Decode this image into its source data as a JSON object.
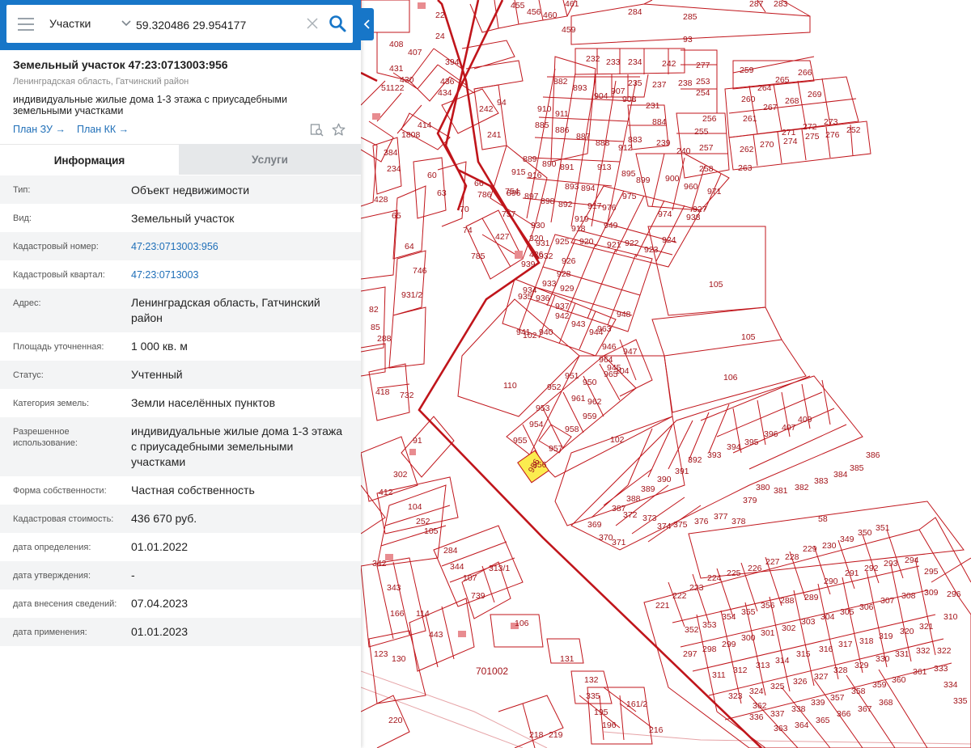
{
  "search": {
    "type_label": "Участки",
    "query": "59.320486 29.954177"
  },
  "parcel": {
    "title": "Земельный участок 47:23:0713003:956",
    "region": "Ленинградская область, Гатчинский район",
    "purpose": "индивидуальные жилые дома 1-3 этажа с приусадебными земельными участками",
    "plan_zu": "План ЗУ",
    "plan_kk": "План КК"
  },
  "tabs": {
    "info": "Информация",
    "services": "Услуги"
  },
  "rows": [
    {
      "label": "Тип:",
      "value": "Объект недвижимости"
    },
    {
      "label": "Вид:",
      "value": "Земельный участок"
    },
    {
      "label": "Кадастровый номер:",
      "value": "47:23:0713003:956"
    },
    {
      "label": "Кадастровый квартал:",
      "value": "47:23:0713003"
    },
    {
      "label": "Адрес:",
      "value": "Ленинградская область, Гатчинский район"
    },
    {
      "label": "Площадь уточненная:",
      "value": "1 000 кв. м"
    },
    {
      "label": "Статус:",
      "value": "Учтенный"
    },
    {
      "label": "Категория земель:",
      "value": "Земли населённых пунктов"
    },
    {
      "label": "Разрешенное использование:",
      "value": "индивидуальные жилые дома 1-3 этажа с приусадебными земельными участками"
    },
    {
      "label": "Форма собственности:",
      "value": "Частная собственность"
    },
    {
      "label": "Кадастровая стоимость:",
      "value": "436 670 руб."
    },
    {
      "label": "дата определения:",
      "value": "01.01.2022"
    },
    {
      "label": "дата утверждения:",
      "value": "-"
    },
    {
      "label": "дата внесения сведений:",
      "value": "07.04.2023"
    },
    {
      "label": "дата применения:",
      "value": "01.01.2023"
    }
  ],
  "map": {
    "selected_parcel": "956",
    "quarter_label": "701002",
    "plot_color": "#c0151b",
    "selected_color": "#fbec4f",
    "labels": [
      "93",
      "284",
      "285",
      "287",
      "283",
      "455",
      "456",
      "460",
      "461",
      "459",
      "22",
      "24",
      "408",
      "407",
      "431",
      "430",
      "51122",
      "394",
      "436",
      "434",
      "232",
      "233",
      "234",
      "242",
      "277",
      "253",
      "254",
      "259",
      "264",
      "265",
      "266",
      "260",
      "267",
      "268",
      "269",
      "882",
      "893",
      "904",
      "907",
      "908",
      "231",
      "235",
      "237",
      "238",
      "255",
      "256",
      "257",
      "258",
      "261",
      "271",
      "272",
      "273",
      "262",
      "270",
      "274",
      "275",
      "276",
      "252",
      "263",
      "94",
      "242",
      "241",
      "414",
      "1808",
      "910",
      "911",
      "885",
      "886",
      "887",
      "888",
      "912",
      "883",
      "884",
      "239",
      "240",
      "913",
      "915",
      "916",
      "889",
      "890",
      "891",
      "896",
      "897",
      "898",
      "892",
      "893",
      "894",
      "895",
      "899",
      "900",
      "960",
      "971",
      "927",
      "938",
      "974",
      "975",
      "976",
      "949",
      "917",
      "918",
      "919",
      "920",
      "921",
      "922",
      "923",
      "924",
      "925",
      "926",
      "928",
      "929",
      "930",
      "931",
      "932",
      "933",
      "934",
      "935",
      "936",
      "937",
      "939",
      "940",
      "941",
      "942",
      "943",
      "944",
      "945",
      "946",
      "947",
      "948",
      "963",
      "964",
      "965",
      "950",
      "951",
      "952",
      "953",
      "954",
      "955",
      "956",
      "957",
      "958",
      "959",
      "961",
      "962",
      "104",
      "105",
      "105",
      "106",
      "102",
      "102",
      "110",
      "58",
      "60",
      "63",
      "66",
      "70",
      "74",
      "785",
      "786",
      "754",
      "757",
      "320",
      "426",
      "427",
      "428",
      "384",
      "234",
      "65",
      "64",
      "746",
      "931/2",
      "82",
      "85",
      "288",
      "418",
      "732",
      "91",
      "412",
      "302",
      "104",
      "252",
      "105",
      "284",
      "344",
      "107",
      "739",
      "313/1",
      "106",
      "342",
      "343",
      "166",
      "114",
      "443",
      "123",
      "130",
      "131",
      "132",
      "335",
      "195",
      "196",
      "161/2",
      "216",
      "218",
      "219",
      "220",
      "221",
      "222",
      "223",
      "224",
      "225",
      "226",
      "227",
      "228",
      "229",
      "230",
      "349",
      "350",
      "351",
      "352",
      "353",
      "354",
      "355",
      "356",
      "288",
      "289",
      "290",
      "291",
      "292",
      "293",
      "294",
      "295",
      "296",
      "297",
      "298",
      "299",
      "300",
      "301",
      "302",
      "303",
      "304",
      "305",
      "306",
      "307",
      "308",
      "309",
      "310",
      "311",
      "312",
      "313",
      "314",
      "315",
      "316",
      "317",
      "318",
      "319",
      "320",
      "321",
      "322",
      "323",
      "324",
      "325",
      "326",
      "327",
      "328",
      "329",
      "330",
      "331",
      "332",
      "333",
      "334",
      "335",
      "336",
      "337",
      "338",
      "339",
      "357",
      "358",
      "359",
      "360",
      "361",
      "362",
      "363",
      "364",
      "365",
      "366",
      "367",
      "368",
      "369",
      "370",
      "371",
      "372",
      "373",
      "374",
      "375",
      "376",
      "377",
      "378",
      "379",
      "380",
      "381",
      "382",
      "383",
      "384",
      "385",
      "386",
      "387",
      "388",
      "389",
      "390",
      "391",
      "392",
      "393",
      "394",
      "395",
      "396",
      "407",
      "409"
    ]
  }
}
